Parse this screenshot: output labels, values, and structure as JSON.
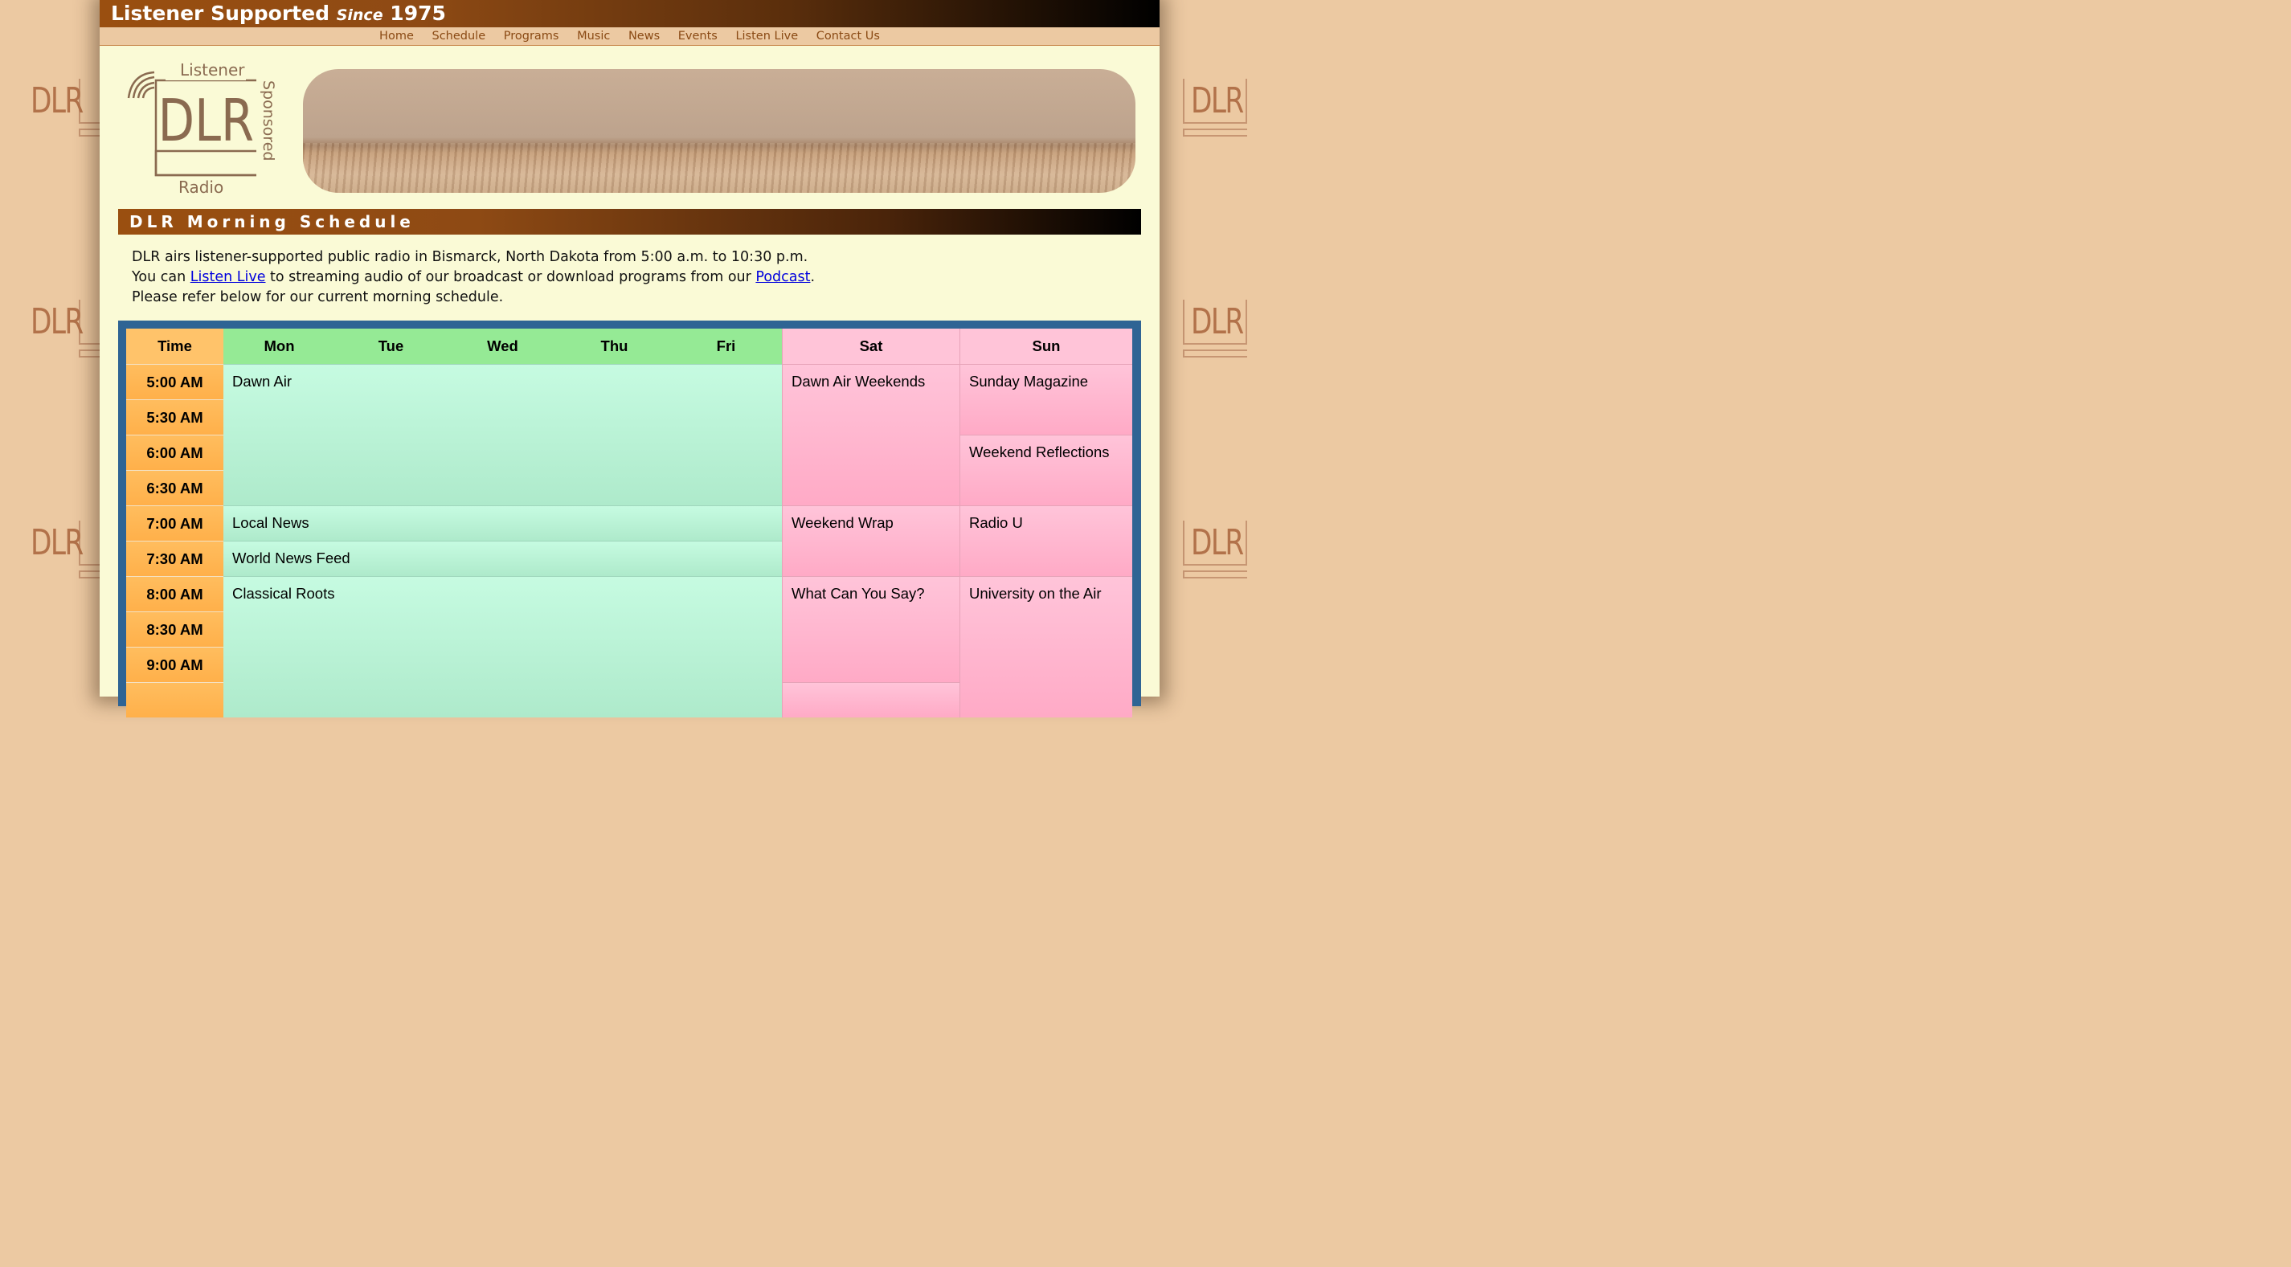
{
  "header": {
    "tagline_start": "Listener Supported",
    "tagline_since": "Since",
    "tagline_year": "1975"
  },
  "nav": {
    "items": [
      "Home",
      "Schedule",
      "Programs",
      "Music",
      "News",
      "Events",
      "Listen Live",
      "Contact Us"
    ]
  },
  "logo": {
    "top_text": "Listener",
    "main_text": "DLR",
    "side_text": "Sponsored",
    "bottom_text": "Radio"
  },
  "watermark_text": "DLR",
  "section": {
    "title": "DLR Morning Schedule"
  },
  "intro": {
    "line1": "DLR airs listener-supported public radio in Bismarck, North Dakota from 5:00 a.m. to 10:30 p.m.",
    "line2_before": "You can ",
    "line2_link1": "Listen Live",
    "line2_middle": " to streaming audio of our broadcast or download programs from our ",
    "line2_link2": "Podcast",
    "line2_end": ".",
    "line3": "Please refer below for our current morning schedule."
  },
  "schedule": {
    "headers": [
      "Time",
      "Mon",
      "Tue",
      "Wed",
      "Thu",
      "Fri",
      "Sat",
      "Sun"
    ],
    "times": [
      "5:00 AM",
      "5:30 AM",
      "6:00 AM",
      "6:30 AM",
      "7:00 AM",
      "7:30 AM",
      "8:00 AM",
      "8:30 AM",
      "9:00 AM"
    ],
    "weekday": {
      "dawn_air": "Dawn Air",
      "local_news": "Local News",
      "world_news": "World News Feed",
      "classical": "Classical Roots"
    },
    "saturday": {
      "dawn_air_weekends": "Dawn Air Weekends",
      "weekend_wrap": "Weekend Wrap",
      "what_can_you_say": "What Can You Say?"
    },
    "sunday": {
      "sunday_magazine": "Sunday Magazine",
      "weekend_reflections": "Weekend Reflections",
      "radio_u": "Radio U",
      "university": "University on the Air"
    }
  },
  "colors": {
    "background": "#ecc9a2",
    "page": "#fafad6",
    "header_brown": "#9a4f10",
    "schedule_frame": "#2f6494",
    "time_column": "#ffb04a",
    "weekday_header": "#95ea95",
    "weekday_cell": "#b8f4d6",
    "weekend_cell": "#ffb6cf",
    "link": "#0000dd"
  }
}
